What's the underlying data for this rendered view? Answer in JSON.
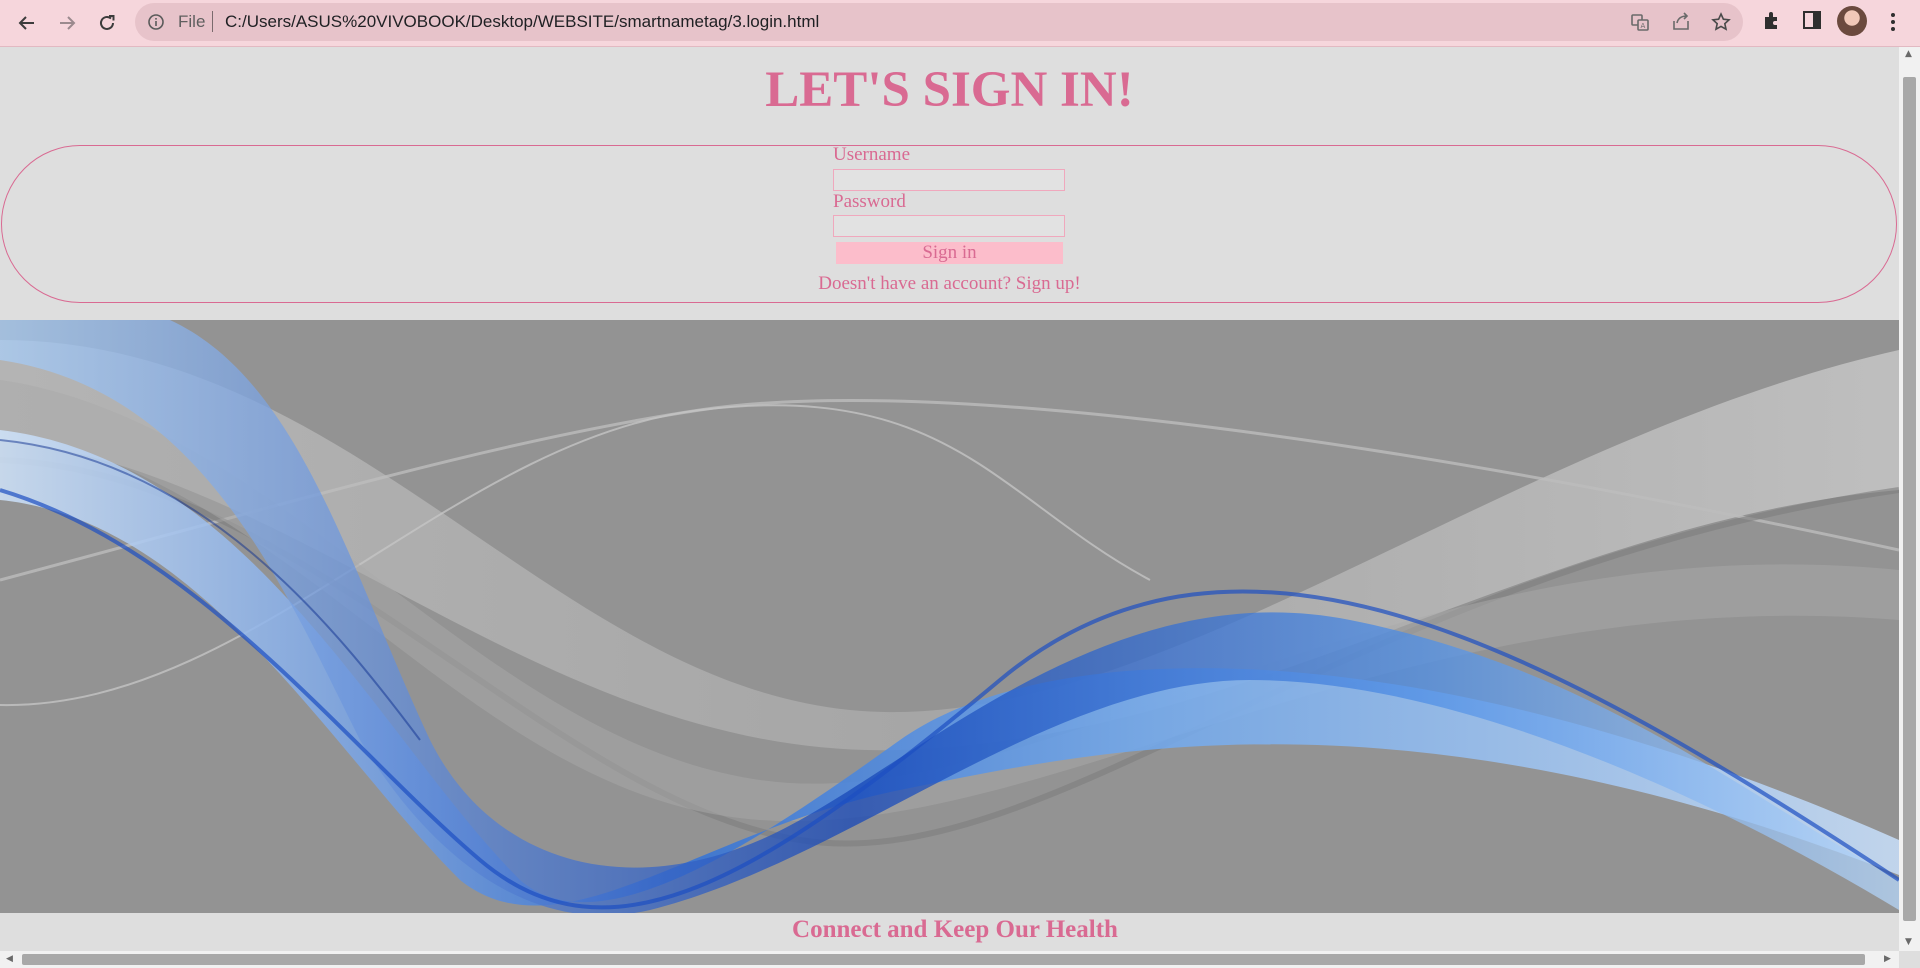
{
  "browser": {
    "omnibox": {
      "file_label": "File",
      "url": "C:/Users/ASUS%20VIVOBOOK/Desktop/WEBSITE/smartnametag/3.login.html"
    },
    "icons": [
      "back-icon",
      "forward-icon",
      "reload-icon",
      "info-icon",
      "translate-icon",
      "share-icon",
      "star-icon",
      "extensions-icon",
      "side-panel-icon",
      "profile-avatar",
      "menu-icon"
    ]
  },
  "page": {
    "title": "LET'S SIGN IN!",
    "form": {
      "username_label": "Username",
      "username_value": "",
      "password_label": "Password",
      "password_value": "",
      "submit_label": "Sign in"
    },
    "signup_text": "Doesn't have an account? Sign up!",
    "tagline": "Connect and Keep Our Health"
  },
  "colors": {
    "accent_pink": "#d96a92",
    "button_pink": "#fcbdcb",
    "chrome_pink": "#f6d6dc",
    "page_bg": "#dedede",
    "banner_bg": "#939393"
  }
}
